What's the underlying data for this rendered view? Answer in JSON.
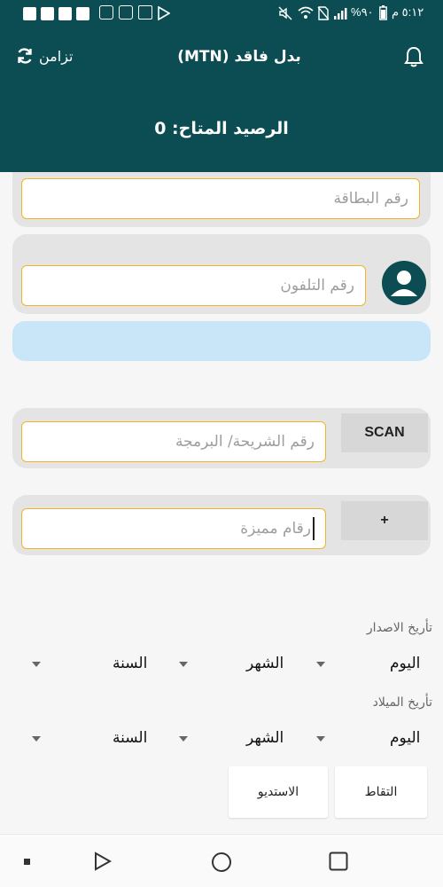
{
  "status_bar": {
    "time": "٥:١٢ م",
    "battery": "%٩٠"
  },
  "header": {
    "title": "بدل فاقد (MTN)",
    "sync_label": "تزامن",
    "balance": "الرصيد المتاح: 0"
  },
  "form": {
    "card_number_placeholder": "رقم البطاقة",
    "phone_placeholder": "رقم التلفون",
    "sim_placeholder": "رقم الشريحة/ البرمجة",
    "scan_label": "SCAN",
    "special_placeholder": "رقام مميزة",
    "plus_label": "+"
  },
  "dates": {
    "issue_label": "تأريخ الاصدار",
    "birth_label": "تأريخ الميلاد",
    "day": "اليوم",
    "month": "الشهر",
    "year": "السنة"
  },
  "actions": {
    "capture_label": "التقاط",
    "studio_label": "الاستديو"
  },
  "colors": {
    "primary": "#0b4d52",
    "field_border": "#f0b429",
    "info_bar": "#c8e6f8"
  }
}
